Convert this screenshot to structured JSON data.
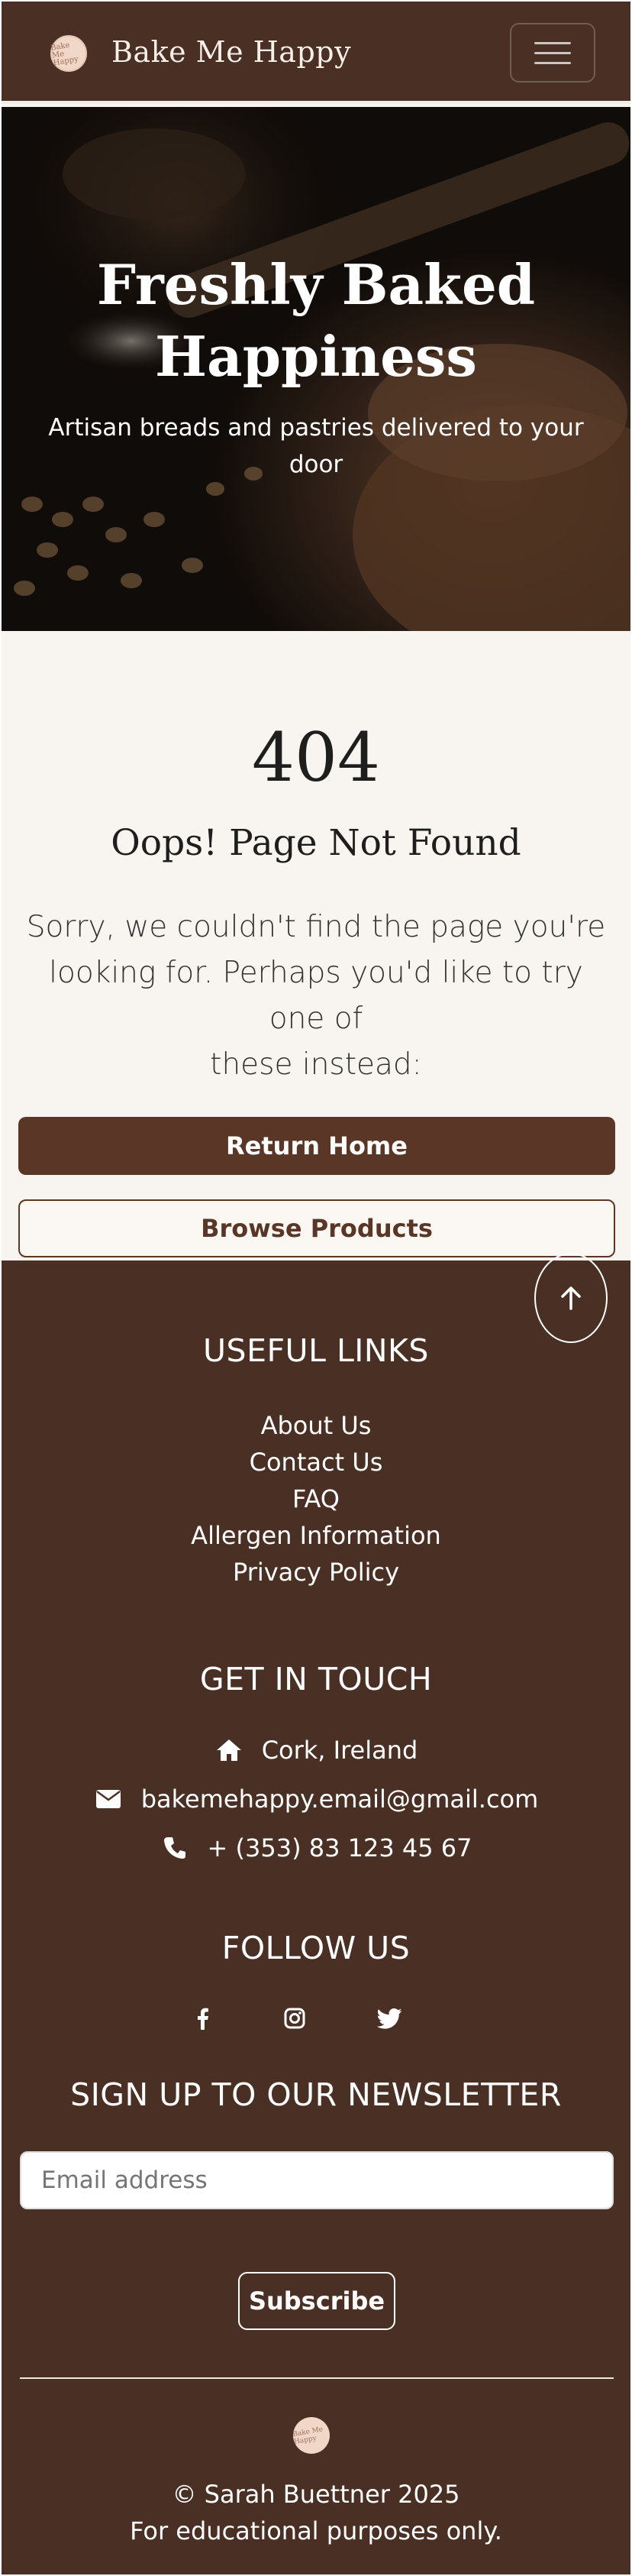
{
  "navbar": {
    "logo_text": "Bake Me Happy",
    "brand": "Bake Me Happy",
    "toggle_icon": "hamburger-icon"
  },
  "hero": {
    "title_line1": "Freshly Baked",
    "title_line2": "Happiness",
    "subtitle_line1": "Artisan breads and pastries delivered to your",
    "subtitle_line2": "door"
  },
  "error": {
    "code": "404",
    "title": "Oops! Page Not Found",
    "text_line1": "Sorry, we couldn't find the page you're",
    "text_line2": "looking for. Perhaps you'd like to try one of",
    "text_line3": "these instead:"
  },
  "actions": {
    "home_label": "Return Home",
    "browse_label": "Browse Products"
  },
  "footer": {
    "links_heading": "USEFUL LINKS",
    "links": [
      "About Us",
      "Contact Us",
      "FAQ",
      "Allergen Information",
      "Privacy Policy"
    ],
    "contact_heading": "GET IN TOUCH",
    "contact": {
      "location": "Cork, Ireland",
      "email": "bakemehappy.email@gmail.com",
      "phone": "+ (353) 83 123 45 67"
    },
    "follow_heading": "FOLLOW US",
    "social_icons": [
      "facebook-icon",
      "instagram-icon",
      "twitter-icon"
    ],
    "newsletter_heading": "SIGN UP TO OUR NEWSLETTER",
    "email_placeholder": "Email address",
    "subscribe_label": "Subscribe",
    "logo_text": "Bake Me Happy",
    "copyright": "© Sarah Buettner 2025",
    "note": "For educational purposes only."
  },
  "colors": {
    "brand_brown": "#4a3024",
    "button_brown": "#5a3627",
    "cream": "#f8f5f0"
  }
}
